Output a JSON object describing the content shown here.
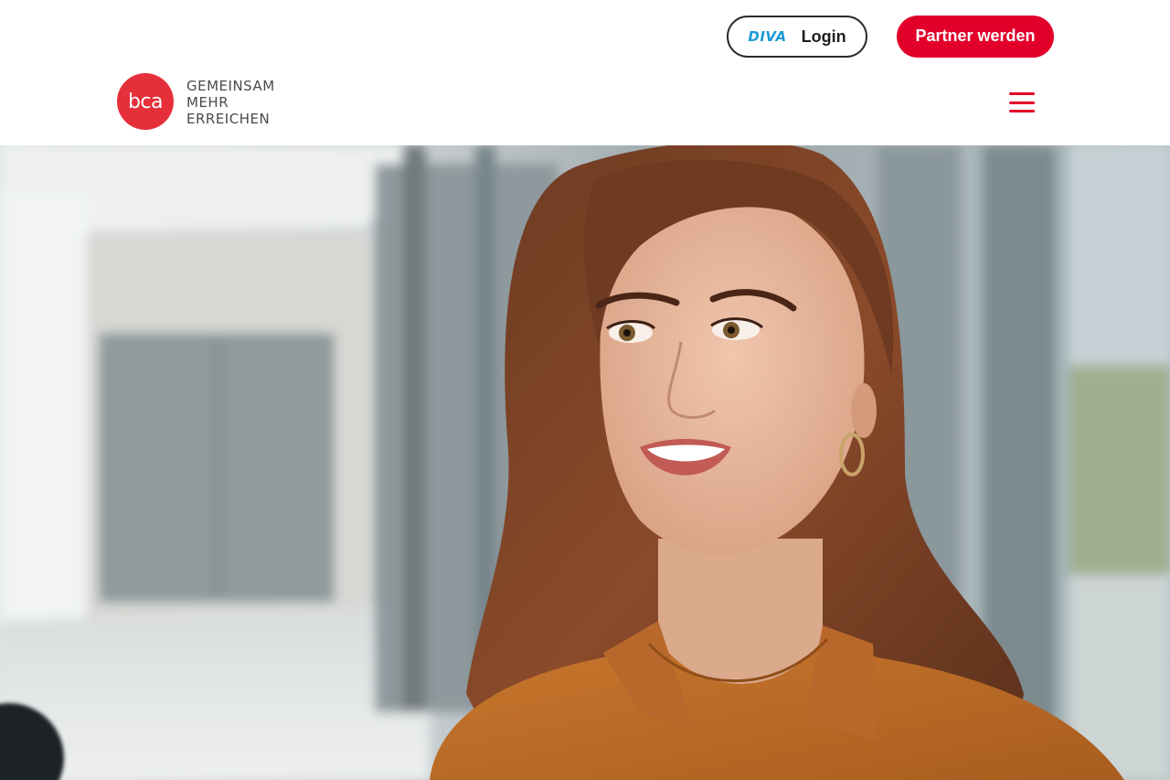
{
  "header": {
    "login": {
      "brand": "DIVA",
      "label": "Login"
    },
    "partner_button": "Partner werden",
    "brand": {
      "logo_text": "bca",
      "tagline": [
        "GEMEINSAM",
        "MEHR",
        "ERREICHEN"
      ]
    },
    "menu_icon": "hamburger-menu-icon"
  },
  "hero": {
    "image": "woman-smiling-in-office-corridor"
  },
  "colors": {
    "brand_red": "#e2002b",
    "logo_red": "#e5303b",
    "diva_blue": "#1a9ad6",
    "text_dark": "#1f1f1f"
  }
}
